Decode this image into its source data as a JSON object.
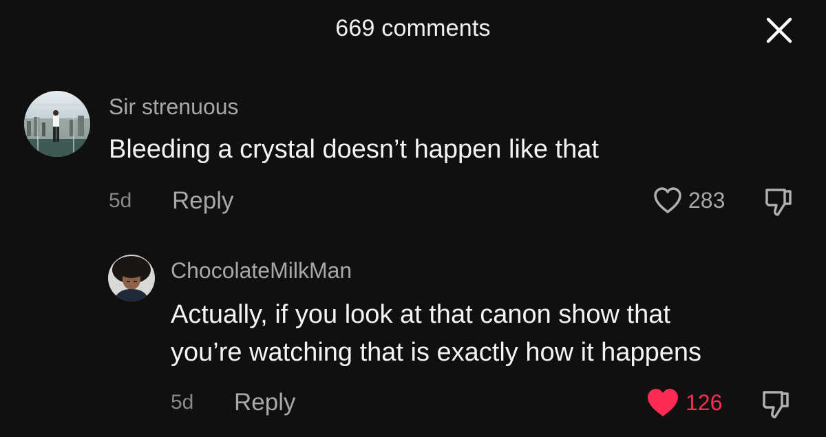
{
  "header": {
    "title": "669 comments"
  },
  "comments": [
    {
      "username": "Sir strenuous",
      "text_lines": [
        "Bleeding a crystal doesn’t happen like that"
      ],
      "time": "5d",
      "reply_label": "Reply",
      "likes": "283",
      "liked": false
    },
    {
      "username": "ChocolateMilkMan",
      "text_lines": [
        "Actually, if you look at that canon show that",
        "you’re watching that is exactly how it happens"
      ],
      "time": "5d",
      "reply_label": "Reply",
      "likes": "126",
      "liked": true
    }
  ],
  "colors": {
    "background": "#101010",
    "username": "#a8a8a8",
    "text": "#f4f4f4",
    "liked": "#fe2c55"
  },
  "icons": {
    "close": "close-icon",
    "like": "heart-icon",
    "dislike": "thumbs-down-icon"
  }
}
